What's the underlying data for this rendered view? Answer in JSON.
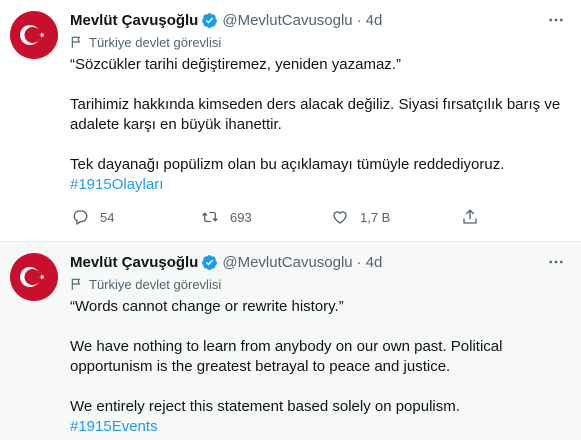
{
  "tweets": [
    {
      "author": "Mevlüt Çavuşoğlu",
      "handle": "@MevlutCavusoglu",
      "time": "4d",
      "label": "Türkiye devlet görevlisi",
      "paragraphs": [
        "“Sözcükler tarihi değiştiremez, yeniden yazamaz.”",
        "Tarihimiz hakkında kimseden ders alacak değiliz. Siyasi fırsatçılık barış ve adalete karşı en büyük ihanettir.",
        "Tek dayanağı popülizm olan bu  açıklamayı tümüyle reddediyoruz."
      ],
      "hashtag": "#1915Olayları",
      "replies": "54",
      "retweets": "693",
      "likes": "1,7 B"
    },
    {
      "author": "Mevlüt Çavuşoğlu",
      "handle": "@MevlutCavusoglu",
      "time": "4d",
      "label": "Türkiye devlet görevlisi",
      "paragraphs": [
        "“Words cannot change or rewrite history.”",
        "We have nothing to learn from anybody on our own past. Political opportunism is the greatest betrayal to peace and justice.",
        "We entirely reject this statement based solely on populism."
      ],
      "hashtag": "#1915Events"
    }
  ],
  "colors": {
    "link": "#1d9bf0",
    "verified": "#1d9bf0",
    "avatar_red": "#c8102e",
    "secondary_text": "#536471"
  },
  "icons": [
    "verified-badge-icon",
    "more-icon",
    "flag-icon",
    "reply-icon",
    "retweet-icon",
    "like-icon",
    "share-icon"
  ]
}
